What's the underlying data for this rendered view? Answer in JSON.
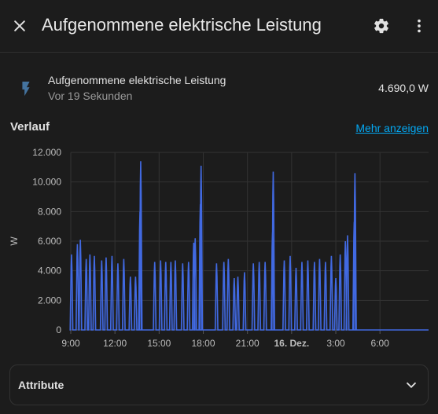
{
  "header": {
    "title": "Aufgenommene elektrische Leistung",
    "close_icon": "close-icon",
    "settings_icon": "gear-icon",
    "menu_icon": "dots-vertical-icon"
  },
  "entity": {
    "name": "Aufgenommene elektrische Leistung",
    "last_changed": "Vor 19 Sekunden",
    "state": "4.690,0 W",
    "icon": "flash-icon"
  },
  "history": {
    "title": "Verlauf",
    "more_link": "Mehr anzeigen"
  },
  "chart_data": {
    "type": "line",
    "ylabel": "W",
    "ylim": [
      0,
      12000
    ],
    "yticks": [
      "0",
      "2.000",
      "4.000",
      "6.000",
      "8.000",
      "10.000",
      "12.000"
    ],
    "xticks": [
      "9:00",
      "12:00",
      "15:00",
      "18:00",
      "21:00",
      "16. Dez.",
      "3:00",
      "6:00"
    ],
    "x_hours": [
      9,
      12,
      15,
      18,
      21,
      24,
      27,
      30
    ],
    "xlim_hours": [
      9,
      33.3
    ],
    "color": "#4169e1",
    "series": [
      {
        "peaks": [
          [
            9.05,
            5100
          ],
          [
            9.45,
            5800
          ],
          [
            9.65,
            6100
          ],
          [
            10.05,
            4800
          ],
          [
            10.3,
            5100
          ],
          [
            10.6,
            5000
          ],
          [
            11.1,
            4700
          ],
          [
            11.4,
            4900
          ],
          [
            11.8,
            5000
          ],
          [
            12.2,
            4500
          ],
          [
            12.6,
            4800
          ],
          [
            13.05,
            3600
          ],
          [
            13.4,
            3600
          ],
          [
            13.7,
            8000
          ],
          [
            13.75,
            11400
          ],
          [
            14.7,
            4600
          ],
          [
            15.1,
            4700
          ],
          [
            15.45,
            4600
          ],
          [
            15.8,
            4600
          ],
          [
            16.1,
            4700
          ],
          [
            16.6,
            4500
          ],
          [
            17.0,
            4600
          ],
          [
            17.35,
            5900
          ],
          [
            17.45,
            6200
          ],
          [
            17.8,
            8500
          ],
          [
            17.85,
            11100
          ],
          [
            18.9,
            4500
          ],
          [
            19.4,
            4600
          ],
          [
            19.7,
            4800
          ],
          [
            20.1,
            3500
          ],
          [
            20.35,
            3600
          ],
          [
            20.8,
            3900
          ],
          [
            21.4,
            4500
          ],
          [
            21.8,
            4600
          ],
          [
            22.2,
            4600
          ],
          [
            22.7,
            6600
          ],
          [
            22.75,
            10700
          ],
          [
            23.5,
            4700
          ],
          [
            23.9,
            5000
          ],
          [
            24.3,
            4200
          ],
          [
            24.7,
            4600
          ],
          [
            25.1,
            4700
          ],
          [
            25.55,
            4600
          ],
          [
            25.9,
            4800
          ],
          [
            26.3,
            4600
          ],
          [
            26.7,
            5000
          ],
          [
            27.0,
            3500
          ],
          [
            27.3,
            5100
          ],
          [
            27.65,
            6000
          ],
          [
            27.8,
            6400
          ],
          [
            28.25,
            7300
          ],
          [
            28.3,
            10600
          ]
        ]
      }
    ]
  },
  "attributes": {
    "label": "Attribute",
    "chevron_icon": "chevron-down-icon"
  }
}
